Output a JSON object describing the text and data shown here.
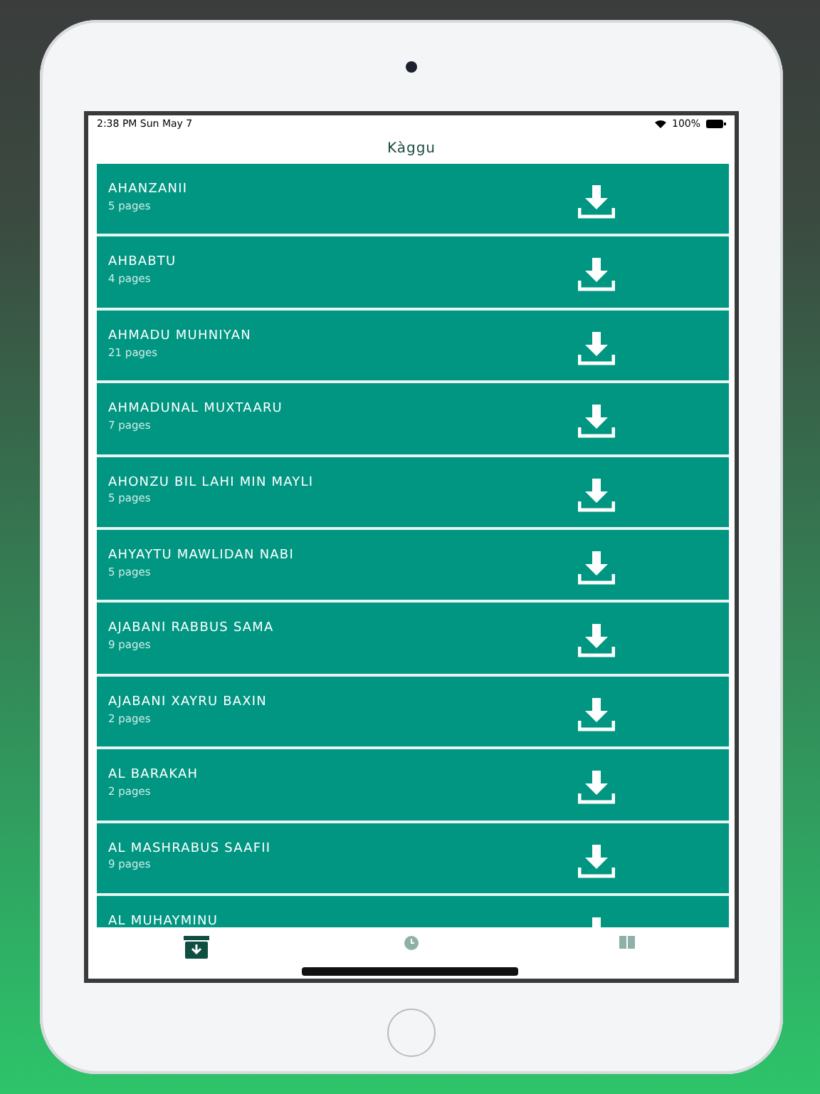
{
  "status_bar": {
    "time": "2:38 PM",
    "date": "Sun May 7",
    "battery": "100%"
  },
  "nav": {
    "title": "Kàggu"
  },
  "items": [
    {
      "title": "AHANZANII",
      "pages": "5 pages"
    },
    {
      "title": "AHBABTU",
      "pages": "4 pages"
    },
    {
      "title": "AHMADU MUHNIYAN",
      "pages": "21 pages"
    },
    {
      "title": "AHMADUNAL MUXTAARU",
      "pages": "7 pages"
    },
    {
      "title": "AHONZU BIL LAHI MIN MAYLI",
      "pages": "5 pages"
    },
    {
      "title": "AHYAYTU MAWLIDAN NABI",
      "pages": "5 pages"
    },
    {
      "title": "AJABANI RABBUS SAMA",
      "pages": "9 pages"
    },
    {
      "title": "AJABANI XAYRU BAXIN",
      "pages": "2 pages"
    },
    {
      "title": "AL BARAKAH",
      "pages": "2 pages"
    },
    {
      "title": "AL MASHRABUS SAAFII",
      "pages": "9 pages"
    },
    {
      "title": "AL MUHAYMINU"
    }
  ],
  "tabs": [
    {
      "kind": "downloads",
      "selected": true
    },
    {
      "kind": "history",
      "selected": false
    },
    {
      "kind": "library",
      "selected": false
    }
  ]
}
